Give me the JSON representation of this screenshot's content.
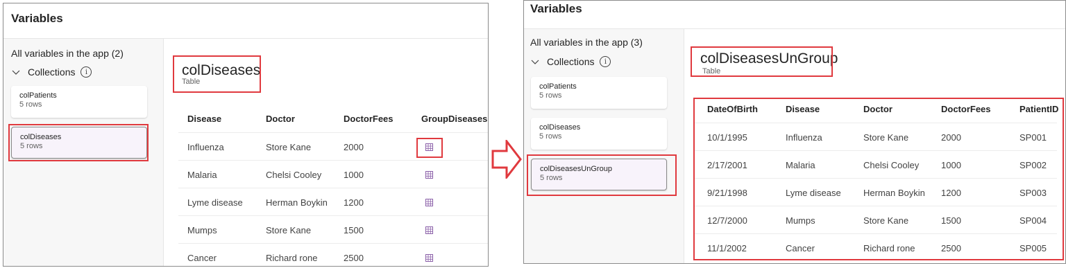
{
  "left": {
    "title": "Variables",
    "count_label": "All variables in the app (2)",
    "collections_label": "Collections",
    "cards": [
      {
        "name": "colPatients",
        "rows": "5 rows"
      },
      {
        "name": "colDiseases",
        "rows": "5 rows"
      }
    ],
    "selected": {
      "name": "colDiseases",
      "type": "Table"
    },
    "columns": [
      "Disease",
      "Doctor",
      "DoctorFees",
      "GroupDiseases"
    ],
    "rows": [
      {
        "disease": "Influenza",
        "doctor": "Store Kane",
        "fees": "2000",
        "group_icon": "table-icon"
      },
      {
        "disease": "Malaria",
        "doctor": "Chelsi Cooley",
        "fees": "1000",
        "group_icon": "table-icon"
      },
      {
        "disease": "Lyme disease",
        "doctor": "Herman Boykin",
        "fees": "1200",
        "group_icon": "table-icon"
      },
      {
        "disease": "Mumps",
        "doctor": "Store Kane",
        "fees": "1500",
        "group_icon": "table-icon"
      },
      {
        "disease": "Cancer",
        "doctor": "Richard rone",
        "fees": "2500",
        "group_icon": "table-icon"
      }
    ]
  },
  "right": {
    "title": "Variables",
    "count_label": "All variables in the app (3)",
    "collections_label": "Collections",
    "cards": [
      {
        "name": "colPatients",
        "rows": "5 rows"
      },
      {
        "name": "colDiseases",
        "rows": "5 rows"
      },
      {
        "name": "colDiseasesUnGroup",
        "rows": "5 rows"
      }
    ],
    "selected": {
      "name": "colDiseasesUnGroup",
      "type": "Table"
    },
    "columns": [
      "DateOfBirth",
      "Disease",
      "Doctor",
      "DoctorFees",
      "PatientID"
    ],
    "rows": [
      {
        "dob": "10/1/1995",
        "disease": "Influenza",
        "doctor": "Store Kane",
        "fees": "2000",
        "pid": "SP001"
      },
      {
        "dob": "2/17/2001",
        "disease": "Malaria",
        "doctor": "Chelsi Cooley",
        "fees": "1000",
        "pid": "SP002"
      },
      {
        "dob": "9/21/1998",
        "disease": "Lyme disease",
        "doctor": "Herman Boykin",
        "fees": "1200",
        "pid": "SP003"
      },
      {
        "dob": "12/7/2000",
        "disease": "Mumps",
        "doctor": "Store Kane",
        "fees": "1500",
        "pid": "SP004"
      },
      {
        "dob": "11/1/2002",
        "disease": "Cancer",
        "doctor": "Richard rone",
        "fees": "2500",
        "pid": "SP005"
      }
    ]
  },
  "colors": {
    "highlight_red": "#e0393e",
    "selected_card": "#f8f3fb",
    "table_icon": "#8a5fa8"
  },
  "icons": [
    "chevron-down-icon",
    "info-icon",
    "table-icon",
    "right-arrow-icon"
  ]
}
